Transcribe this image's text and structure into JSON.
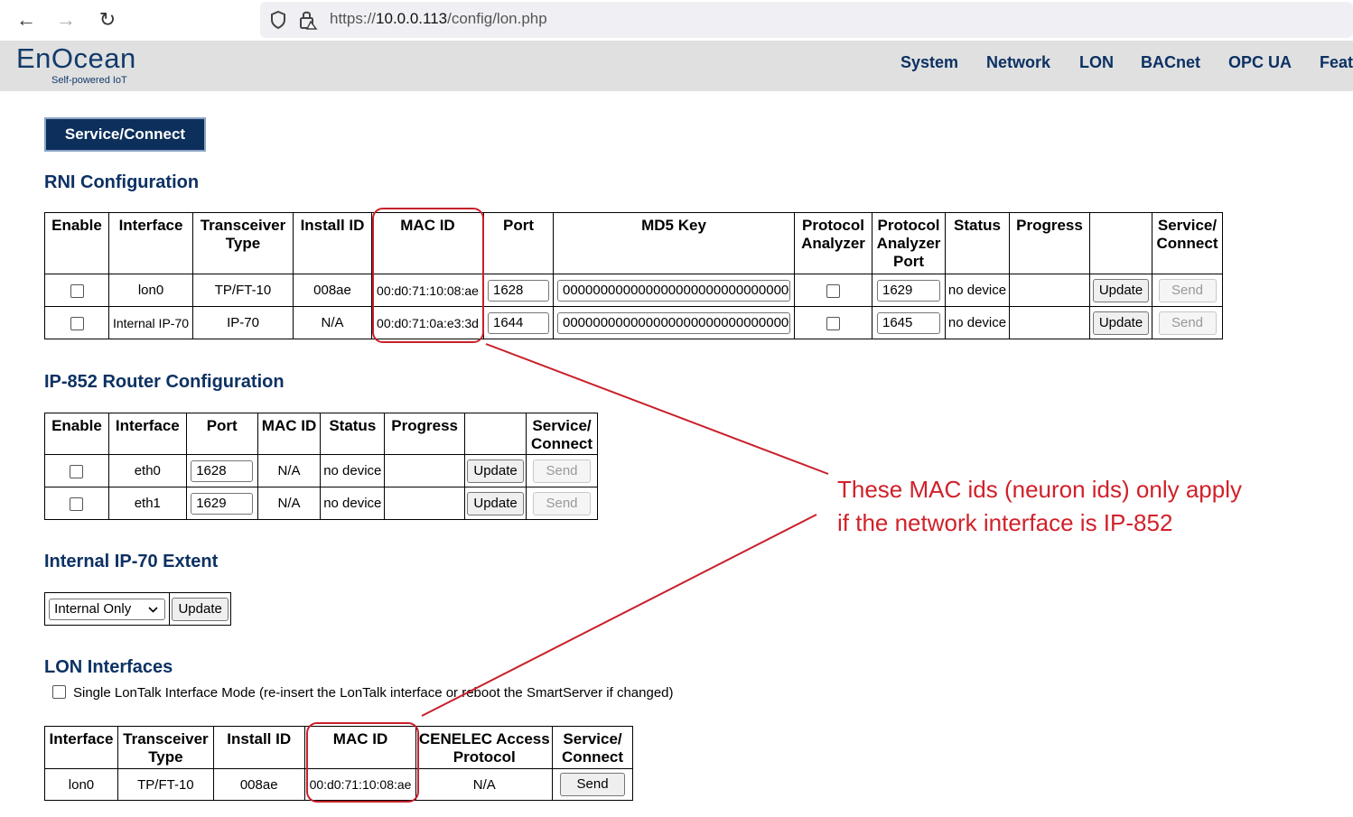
{
  "browser": {
    "back_icon": "←",
    "forward_icon": "→",
    "reload_icon": "↻",
    "url_prefix": "https://",
    "url_host": "10.0.0.113",
    "url_path": "/config/lon.php"
  },
  "header": {
    "logo": "EnOcean",
    "logo_sub": "Self-powered IoT",
    "menu": [
      "System",
      "Network",
      "LON",
      "BACnet",
      "OPC UA",
      "Feat"
    ]
  },
  "service_button": "Service/Connect",
  "rni": {
    "title": "RNI Configuration",
    "headers": [
      "Enable",
      "Interface",
      "Transceiver Type",
      "Install ID",
      "MAC ID",
      "Port",
      "MD5 Key",
      "Protocol Analyzer",
      "Protocol Analyzer Port",
      "Status",
      "Progress",
      "",
      "Service/ Connect"
    ],
    "rows": [
      {
        "interface": "lon0",
        "type": "TP/FT-10",
        "install_id": "008ae",
        "mac": "00:d0:71:10:08:ae",
        "port": "1628",
        "md5": "00000000000000000000000000000000",
        "pa_port": "1629",
        "status": "no device",
        "update": "Update",
        "send": "Send"
      },
      {
        "interface": "Internal IP-70",
        "type": "IP-70",
        "install_id": "N/A",
        "mac": "00:d0:71:0a:e3:3d",
        "port": "1644",
        "md5": "00000000000000000000000000000000",
        "pa_port": "1645",
        "status": "no device",
        "update": "Update",
        "send": "Send"
      }
    ]
  },
  "router": {
    "title": "IP-852 Router Configuration",
    "headers": [
      "Enable",
      "Interface",
      "Port",
      "MAC ID",
      "Status",
      "Progress",
      "",
      "Service/ Connect"
    ],
    "rows": [
      {
        "interface": "eth0",
        "port": "1628",
        "mac": "N/A",
        "status": "no device",
        "update": "Update",
        "send": "Send"
      },
      {
        "interface": "eth1",
        "port": "1629",
        "mac": "N/A",
        "status": "no device",
        "update": "Update",
        "send": "Send"
      }
    ]
  },
  "extent": {
    "title": "Internal IP-70 Extent",
    "select_value": "Internal Only",
    "update": "Update"
  },
  "lon": {
    "title": "LON Interfaces",
    "single_mode_label": "Single LonTalk Interface Mode (re-insert the LonTalk interface or reboot the SmartServer if changed)",
    "headers": [
      "Interface",
      "Transceiver Type",
      "Install ID",
      "MAC ID",
      "CENELEC Access Protocol",
      "Service/ Connect"
    ],
    "row": {
      "interface": "lon0",
      "type": "TP/FT-10",
      "install_id": "008ae",
      "mac": "00:d0:71:10:08:ae",
      "cenelec": "N/A",
      "send": "Send"
    }
  },
  "annotation": {
    "line1": "These MAC ids (neuron ids) only apply",
    "line2": "if the network interface is IP-852",
    "color": "#d0212a"
  }
}
